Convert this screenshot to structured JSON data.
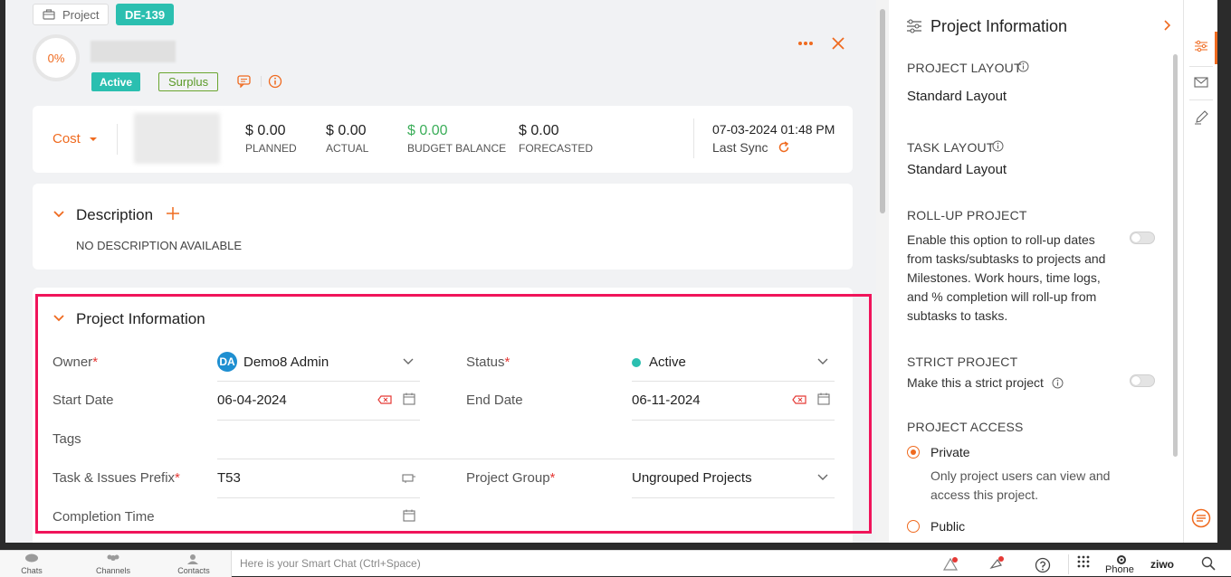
{
  "header": {
    "project_chip": "Project",
    "id_badge": "DE-139",
    "progress": "0%",
    "status_pill": "Active",
    "surplus_pill": "Surplus"
  },
  "budget": {
    "mode": "Cost",
    "planned": {
      "value": "$ 0.00",
      "label": "PLANNED"
    },
    "actual": {
      "value": "$ 0.00",
      "label": "ACTUAL"
    },
    "balance": {
      "value": "$ 0.00",
      "label": "BUDGET BALANCE"
    },
    "forecasted": {
      "value": "$ 0.00",
      "label": "FORECASTED"
    },
    "sync_time": "07-03-2024 01:48 PM",
    "sync_label": "Last Sync"
  },
  "description": {
    "title": "Description",
    "empty_text": "NO DESCRIPTION AVAILABLE"
  },
  "info": {
    "title": "Project Information",
    "owner_label": "Owner",
    "owner_initials": "DA",
    "owner_value": "Demo8 Admin",
    "status_label": "Status",
    "status_value": "Active",
    "start_label": "Start Date",
    "start_value": "06-04-2024",
    "end_label": "End Date",
    "end_value": "06-11-2024",
    "tags_label": "Tags",
    "prefix_label": "Task & Issues Prefix",
    "prefix_value": "T53",
    "group_label": "Project Group",
    "group_value": "Ungrouped Projects",
    "completion_label": "Completion Time",
    "required_mark": "*"
  },
  "side": {
    "title": "Project Information",
    "layout_heading": "PROJECT LAYOUT",
    "layout_value": "Standard Layout",
    "task_layout_heading": "TASK LAYOUT",
    "task_layout_value": "Standard Layout",
    "rollup_heading": "ROLL-UP PROJECT",
    "rollup_text": "Enable this option to roll-up dates from tasks/subtasks to projects and Milestones. Work hours, time logs, and % completion will roll-up from subtasks to tasks.",
    "strict_heading": "STRICT PROJECT",
    "strict_text": "Make this a strict project",
    "access_heading": "PROJECT ACCESS",
    "private_label": "Private",
    "private_desc": "Only project users can view and access this project.",
    "public_label": "Public"
  },
  "bottom": {
    "chats": "Chats",
    "channels": "Channels",
    "contacts": "Contacts",
    "smart_chat": "Here is your Smart Chat (Ctrl+Space)",
    "phone": "Phone",
    "brand": "ziwo"
  },
  "colors": {
    "accent": "#ef6a1f",
    "teal": "#2bbfb0",
    "green": "#3cae5a",
    "highlight": "#f0145a",
    "avatar": "#1e8fd1"
  }
}
